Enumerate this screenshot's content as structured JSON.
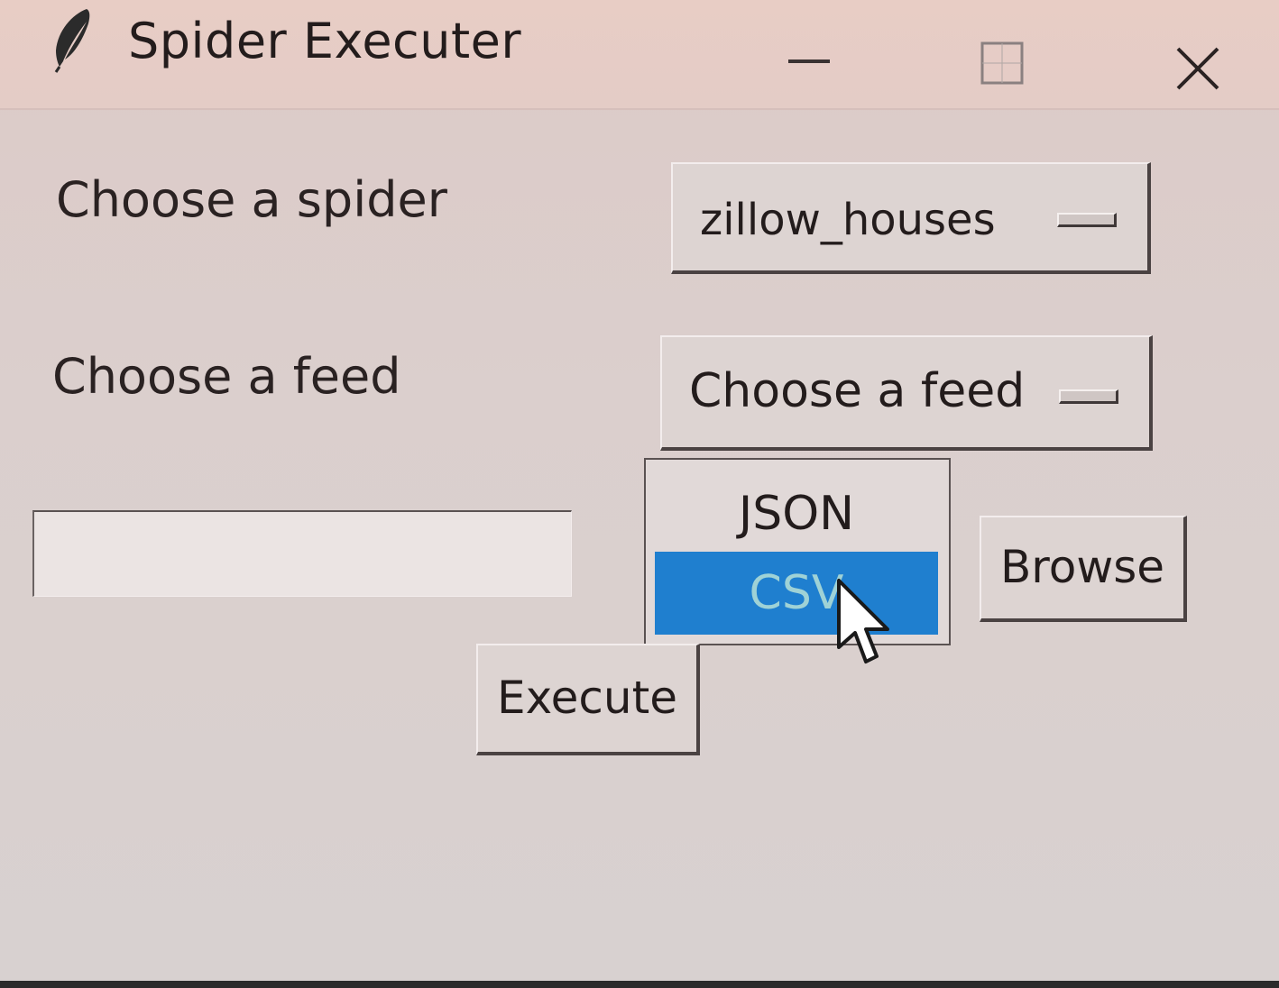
{
  "window": {
    "title": "Spider Executer"
  },
  "form": {
    "spider_label": "Choose a spider",
    "spider_value": "zillow_houses",
    "feed_label": "Choose a feed",
    "feed_value": "Choose a feed",
    "path_value": "",
    "feed_options": [
      "JSON",
      "CSV"
    ],
    "highlighted_option": "CSV",
    "browse_label": "Browse",
    "execute_label": "Execute"
  },
  "colors": {
    "highlight": "#1f7fcf",
    "window_bg": "#dbcfcd"
  }
}
